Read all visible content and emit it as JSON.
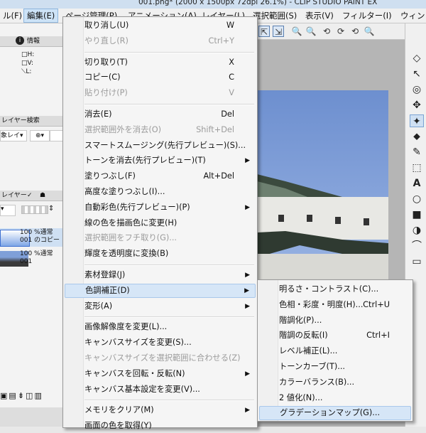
{
  "window": {
    "title": "001.png* (2000 x 1500px 72dpi 26.1%) - CLIP STUDIO PAINT EX"
  },
  "menubar": [
    {
      "label": "ル(F)",
      "x": 0
    },
    {
      "label": "編集(E)",
      "active": true
    },
    {
      "label": "ページ管理(P)"
    },
    {
      "label": "アニメーション(A)"
    },
    {
      "label": "レイヤー(L)"
    },
    {
      "label": "選択範囲(S)"
    },
    {
      "label": "表示(V)"
    },
    {
      "label": "フィルター(I)"
    },
    {
      "label": "ウィンド"
    }
  ],
  "left_panel": {
    "info_tab": "情報",
    "nav_labels": [
      "H:",
      "V:",
      "L:"
    ],
    "layer_search_tab": "レイヤー検索",
    "layer_search_select": "象レイ",
    "layer_tab": "レイヤー",
    "layers": [
      {
        "line1": "100 %通常",
        "line2": "001 のコピー",
        "selected": true
      },
      {
        "line1": "100 %通常",
        "line2": "001",
        "selected": false
      }
    ]
  },
  "edit_menu": {
    "items": [
      {
        "label": "取り消し(U)",
        "shortcut": "W"
      },
      {
        "label": "やり直し(R)",
        "shortcut": "Ctrl+Y",
        "disabled": true
      },
      {
        "sep": true
      },
      {
        "label": "切り取り(T)",
        "shortcut": "X"
      },
      {
        "label": "コピー(C)",
        "shortcut": "C"
      },
      {
        "label": "貼り付け(P)",
        "shortcut": "V",
        "disabled": true
      },
      {
        "sep": true
      },
      {
        "label": "消去(E)",
        "shortcut": "Del"
      },
      {
        "label": "選択範囲外を消去(O)",
        "shortcut": "Shift+Del",
        "disabled": true
      },
      {
        "label": "スマートスムージング(先行プレビュー)(S)..."
      },
      {
        "label": "トーンを消去(先行プレビュー)(T)",
        "submenu": true
      },
      {
        "label": "塗りつぶし(F)",
        "shortcut": "Alt+Del"
      },
      {
        "label": "高度な塗りつぶし(I)..."
      },
      {
        "label": "自動彩色(先行プレビュー)(P)",
        "submenu": true
      },
      {
        "label": "線の色を描画色に変更(H)"
      },
      {
        "label": "選択範囲をフチ取り(G)...",
        "disabled": true
      },
      {
        "label": "輝度を透明度に変換(B)"
      },
      {
        "sep": true
      },
      {
        "label": "素材登録(J)",
        "submenu": true
      },
      {
        "label": "色調補正(D)",
        "submenu": true,
        "highlight": true
      },
      {
        "label": "変形(A)",
        "submenu": true
      },
      {
        "sep": true
      },
      {
        "label": "画像解像度を変更(L)..."
      },
      {
        "label": "キャンバスサイズを変更(S)..."
      },
      {
        "label": "キャンバスサイズを選択範囲に合わせる(Z)",
        "disabled": true
      },
      {
        "label": "キャンバスを回転・反転(N)",
        "submenu": true
      },
      {
        "label": "キャンバス基本設定を変更(V)..."
      },
      {
        "sep": true
      },
      {
        "label": "メモリをクリア(M)",
        "submenu": true
      },
      {
        "label": "画面の色を取得(Y)"
      }
    ]
  },
  "color_submenu": {
    "items": [
      {
        "label": "明るさ・コントラスト(C)..."
      },
      {
        "label": "色相・彩度・明度(H)...",
        "shortcut": "Ctrl+U"
      },
      {
        "label": "階調化(P)..."
      },
      {
        "label": "階調の反転(I)",
        "shortcut": "Ctrl+I"
      },
      {
        "label": "レベル補正(L)..."
      },
      {
        "label": "トーンカーブ(T)..."
      },
      {
        "label": "カラーバランス(B)..."
      },
      {
        "label": "2 値化(N)..."
      },
      {
        "label": "グラデーションマップ(G)...",
        "highlight": true
      }
    ]
  },
  "canvas_toolbar": [
    "⇱",
    "⇲",
    "🔍",
    "🔍",
    "⟲",
    "⟳",
    "⟲",
    "🔍"
  ],
  "tools": [
    "◇",
    "↖",
    "◎",
    "✥",
    "✦",
    "⬥",
    "✎",
    "⬚",
    "A",
    "○",
    "■",
    "◑",
    "⌒",
    "▭"
  ],
  "colors": {
    "accent": "#d6e6f7",
    "menu_bg": "#f5f5f5",
    "sky": "#7f9fd8"
  }
}
